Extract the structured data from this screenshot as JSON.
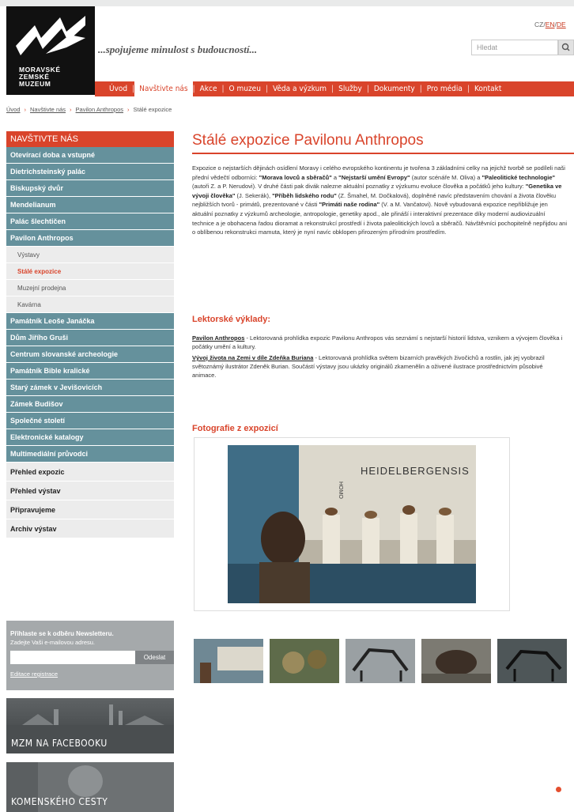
{
  "header": {
    "logo_lines": [
      "MORAVSKÉ",
      "ZEMSKÉ",
      "MUZEUM"
    ],
    "tagline": "...spojujeme minulost s budoucností...",
    "lang": {
      "cz": "CZ",
      "en": "EN",
      "de": "DE"
    },
    "search_placeholder": "Hledat"
  },
  "nav": [
    "Úvod",
    "Navštivte nás",
    "Akce",
    "O muzeu",
    "Věda a výzkum",
    "Služby",
    "Dokumenty",
    "Pro média",
    "Kontakt"
  ],
  "breadcrumb": [
    "Úvod",
    "Navštivte nás",
    "Pavilon Anthropos",
    "Stálé expozice"
  ],
  "sidebar": {
    "heading": "NAVŠTIVTE NÁS",
    "items": [
      "Otevírací doba a vstupné",
      "Dietrichsteinský palác",
      "Biskupský dvůr",
      "Mendelianum",
      "Palác šlechtičen",
      "Pavilon Anthropos"
    ],
    "subitems": [
      "Výstavy",
      "Stálé expozice",
      "Muzejní prodejna",
      "Kavárna"
    ],
    "items2": [
      "Památník Leoše Janáčka",
      "Dům Jiřího Gruši",
      "Centrum slovanské archeologie",
      "Památník Bible kralické",
      "Starý zámek v Jevišovicích",
      "Zámek Budišov",
      "Společné století",
      "Elektronické katalogy",
      "Multimediální průvodci"
    ],
    "plain": [
      "Přehled expozic",
      "Přehled výstav",
      "Připravujeme",
      "Archiv výstav"
    ]
  },
  "newsletter": {
    "title": "Přihlaste se k odběru Newsletteru.",
    "subtitle": "Zadejte Vaši e-mailovou adresu.",
    "button": "Odeslat",
    "link": "Editace registrace"
  },
  "banners": [
    "MZM NA FACEBOOKU",
    "KOMENSKÉHO CESTY"
  ],
  "main": {
    "title": "Stálé expozice Pavilonu Anthropos",
    "intro": [
      {
        "t": "Expozice o nejstarších dějinách osídlení Moravy i celého evropského kontinentu je tvořena 3 základními celky na jejichž tvorbě se podíleli naši přední vědečtí odborníci: "
      },
      {
        "t": "\"Morava lovců a sběračů\"",
        "b": true
      },
      {
        "t": " a "
      },
      {
        "t": "\"Nejstarší umění Evropy\"",
        "b": true
      },
      {
        "t": " (autor scénáře M. Oliva) a "
      },
      {
        "t": "\"Paleolitické technologie\"",
        "b": true
      },
      {
        "t": " (autoři Z. a P. Nerudovi). V druhé části pak divák nalezne aktuální poznatky z výzkumu evoluce člověka a počátků jeho kultury: "
      },
      {
        "t": "\"Genetika ve vývoji člověka\"",
        "b": true
      },
      {
        "t": " (J. Sekerák), "
      },
      {
        "t": "\"Příběh lidského rodu\"",
        "b": true
      },
      {
        "t": " (Z. Šmahel, M. Dočkalová), doplněné navíc představením chování a života člověku nejbližších tvorů - primátů, prezentované v části "
      },
      {
        "t": "\"Primáti naše rodina\"",
        "b": true
      },
      {
        "t": " (V. a M. Vančatovi). Nově vybudovaná expozice nepřibližuje jen aktuální poznatky z výzkumů archeologie, antropologie, genetiky apod., ale přináší i interaktivní prezentace díky moderní audiovizuální technice a je obohacena řadou dioramat a rekonstrukcí prostředí i života paleolitických lovců a sběračů. Návštěvníci pochopitelně nepřijdou ani o oblíbenou rekonstrukci mamuta, který je nyní navíc obklopen přirozeným přírodním prostředím."
      }
    ],
    "lektor_heading": "Lektorské výklady:",
    "lektor1_link": "Pavilon Anthropos",
    "lektor1_text": " - Lektorovaná prohlídka expozic Pavilonu Anthropos vás seznámí s nejstarší historií lidstva, vznikem a vývojem člověka i počátky umění a kultury.",
    "lektor2_link": "Vývoj života na Zemi v díle Zdeňka Buriana",
    "lektor2_text": " - Lektorovaná prohlídka světem bizarních pravěkých živočichů a rostlin, jak jej vyobrazil světoznámý ilustrátor Zdeněk Burian. Součástí výstavy jsou ukázky originálů zkamenělin a oživené ilustrace prostřednictvím působivé animace.",
    "foto_heading": "Fotografie z expozicí",
    "photo_caption": "HEIDELBERGENSIS",
    "photo_caption_small": "HOMO"
  },
  "colors": {
    "accent": "#d9442b",
    "sidebar": "#65919c"
  }
}
